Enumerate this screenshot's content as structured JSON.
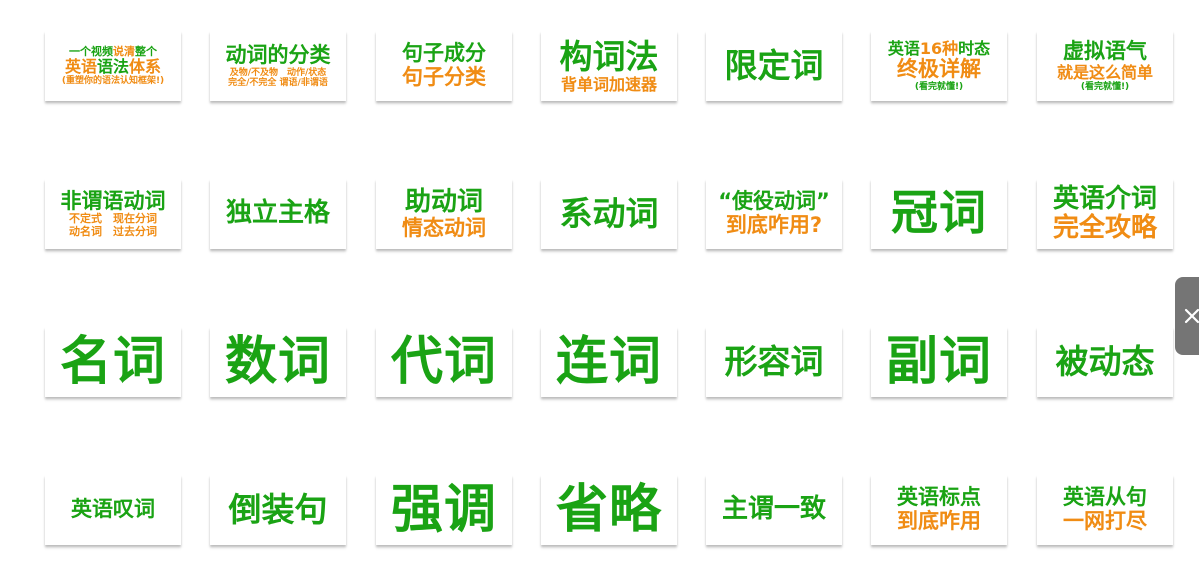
{
  "colors": {
    "green": "#1aa314",
    "orange": "#f08c14",
    "handle": "#757575"
  },
  "close_icon": "close-icon",
  "rows": [
    [
      {
        "name": "full-english-grammar-system",
        "lines": [
          {
            "size": "xs",
            "segs": [
              {
                "t": "一个视频",
                "c": "g"
              },
              {
                "t": "说清",
                "c": "o"
              },
              {
                "t": "整个",
                "c": "g"
              }
            ]
          },
          {
            "size": "sm",
            "segs": [
              {
                "t": "英语",
                "c": "o"
              },
              {
                "t": "语法",
                "c": "g"
              },
              {
                "t": "体系",
                "c": "o"
              }
            ]
          },
          {
            "size": "xxs",
            "segs": [
              {
                "t": "(重塑你的语法认知框架!)",
                "c": "o"
              }
            ]
          }
        ]
      },
      {
        "name": "verb-classification",
        "lines": [
          {
            "size": "md",
            "segs": [
              {
                "t": "动词的分类",
                "c": "g"
              }
            ]
          },
          {
            "size": "xxs",
            "segs": [
              {
                "t": "及物/不及物　动作/状态",
                "c": "o"
              }
            ]
          },
          {
            "size": "xxs",
            "segs": [
              {
                "t": "完全/不完全 谓语/非谓语",
                "c": "o"
              }
            ]
          }
        ]
      },
      {
        "name": "sentence-components",
        "lines": [
          {
            "size": "md",
            "segs": [
              {
                "t": "句子成分",
                "c": "g"
              }
            ]
          },
          {
            "size": "md",
            "segs": [
              {
                "t": "句子分类",
                "c": "o"
              }
            ]
          }
        ]
      },
      {
        "name": "word-formation",
        "lines": [
          {
            "size": "lg",
            "segs": [
              {
                "t": "构词法",
                "c": "g"
              }
            ]
          },
          {
            "size": "sm",
            "segs": [
              {
                "t": "背单词加速器",
                "c": "o"
              }
            ]
          }
        ]
      },
      {
        "name": "determiners",
        "lines": [
          {
            "size": "lg",
            "segs": [
              {
                "t": "限定词",
                "c": "g"
              }
            ]
          }
        ]
      },
      {
        "name": "sixteen-tenses",
        "lines": [
          {
            "size": "sm",
            "segs": [
              {
                "t": "英语",
                "c": "g"
              },
              {
                "t": "16种",
                "c": "o"
              },
              {
                "t": "时态",
                "c": "g"
              }
            ]
          },
          {
            "size": "md",
            "segs": [
              {
                "t": "终极详解",
                "c": "o"
              }
            ]
          },
          {
            "size": "xxs",
            "segs": [
              {
                "t": "(看完就懂!)",
                "c": "g"
              }
            ]
          }
        ]
      },
      {
        "name": "subjunctive-mood",
        "lines": [
          {
            "size": "md",
            "segs": [
              {
                "t": "虚拟语气",
                "c": "g"
              }
            ]
          },
          {
            "size": "sm",
            "segs": [
              {
                "t": "就是这么简单",
                "c": "o"
              }
            ]
          },
          {
            "size": "xxs",
            "segs": [
              {
                "t": "(看完就懂!)",
                "c": "g"
              }
            ]
          }
        ]
      }
    ],
    [
      {
        "name": "non-finite-verbs",
        "lines": [
          {
            "size": "md",
            "segs": [
              {
                "t": "非谓语动词",
                "c": "g"
              }
            ]
          },
          {
            "size": "xs",
            "segs": [
              {
                "t": "不定式　现在分词",
                "c": "o"
              }
            ]
          },
          {
            "size": "xs",
            "segs": [
              {
                "t": "动名词　过去分词",
                "c": "o"
              }
            ]
          }
        ]
      },
      {
        "name": "absolute-construction",
        "lines": [
          {
            "size": "ml",
            "segs": [
              {
                "t": "独立主格",
                "c": "g"
              }
            ]
          }
        ]
      },
      {
        "name": "auxiliary-verbs",
        "lines": [
          {
            "size": "ml",
            "segs": [
              {
                "t": "助动词",
                "c": "g"
              }
            ]
          },
          {
            "size": "md",
            "segs": [
              {
                "t": "情态动词",
                "c": "o"
              }
            ]
          }
        ]
      },
      {
        "name": "linking-verbs",
        "lines": [
          {
            "size": "lg",
            "segs": [
              {
                "t": "系动词",
                "c": "g"
              }
            ]
          }
        ]
      },
      {
        "name": "causative-verbs",
        "lines": [
          {
            "size": "md",
            "segs": [
              {
                "t": "“使役动词”",
                "c": "g"
              }
            ]
          },
          {
            "size": "md",
            "segs": [
              {
                "t": "到底咋用?",
                "c": "o"
              }
            ]
          }
        ]
      },
      {
        "name": "articles",
        "lines": [
          {
            "size": "xl",
            "segs": [
              {
                "t": "冠词",
                "c": "g"
              }
            ]
          }
        ]
      },
      {
        "name": "prepositions",
        "lines": [
          {
            "size": "ml",
            "segs": [
              {
                "t": "英语介词",
                "c": "g"
              }
            ]
          },
          {
            "size": "ml",
            "segs": [
              {
                "t": "完全攻略",
                "c": "o"
              }
            ]
          }
        ]
      }
    ],
    [
      {
        "name": "nouns",
        "lines": [
          {
            "size": "xxl",
            "segs": [
              {
                "t": "名词",
                "c": "g"
              }
            ]
          }
        ]
      },
      {
        "name": "numerals",
        "lines": [
          {
            "size": "xxl",
            "segs": [
              {
                "t": "数词",
                "c": "g"
              }
            ]
          }
        ]
      },
      {
        "name": "pronouns",
        "lines": [
          {
            "size": "xxl",
            "segs": [
              {
                "t": "代词",
                "c": "g"
              }
            ]
          }
        ]
      },
      {
        "name": "conjunctions",
        "lines": [
          {
            "size": "xxl",
            "segs": [
              {
                "t": "连词",
                "c": "g"
              }
            ]
          }
        ]
      },
      {
        "name": "adjectives",
        "lines": [
          {
            "size": "lg",
            "segs": [
              {
                "t": "形容词",
                "c": "g"
              }
            ]
          }
        ]
      },
      {
        "name": "adverbs",
        "lines": [
          {
            "size": "xxl",
            "segs": [
              {
                "t": "副词",
                "c": "g"
              }
            ]
          }
        ]
      },
      {
        "name": "passive-voice",
        "lines": [
          {
            "size": "lg",
            "segs": [
              {
                "t": "被动态",
                "c": "g"
              }
            ]
          }
        ]
      }
    ],
    [
      {
        "name": "interjections",
        "lines": [
          {
            "size": "md",
            "segs": [
              {
                "t": "英语叹词",
                "c": "g"
              }
            ]
          }
        ]
      },
      {
        "name": "inversion",
        "lines": [
          {
            "size": "lg",
            "segs": [
              {
                "t": "倒装句",
                "c": "g"
              }
            ]
          }
        ]
      },
      {
        "name": "emphasis",
        "lines": [
          {
            "size": "xxl",
            "segs": [
              {
                "t": "强调",
                "c": "g"
              }
            ]
          }
        ]
      },
      {
        "name": "ellipsis",
        "lines": [
          {
            "size": "xxl",
            "segs": [
              {
                "t": "省略",
                "c": "g"
              }
            ]
          }
        ]
      },
      {
        "name": "subject-verb-agreement",
        "lines": [
          {
            "size": "ml",
            "segs": [
              {
                "t": "主谓一致",
                "c": "g"
              }
            ]
          }
        ]
      },
      {
        "name": "punctuation",
        "lines": [
          {
            "size": "md",
            "segs": [
              {
                "t": "英语标点",
                "c": "g"
              }
            ]
          },
          {
            "size": "md",
            "segs": [
              {
                "t": "到底咋用",
                "c": "o"
              }
            ]
          }
        ]
      },
      {
        "name": "clauses",
        "lines": [
          {
            "size": "md",
            "segs": [
              {
                "t": "英语从句",
                "c": "g"
              }
            ]
          },
          {
            "size": "md",
            "segs": [
              {
                "t": "一网打尽",
                "c": "o"
              }
            ]
          }
        ]
      }
    ]
  ]
}
